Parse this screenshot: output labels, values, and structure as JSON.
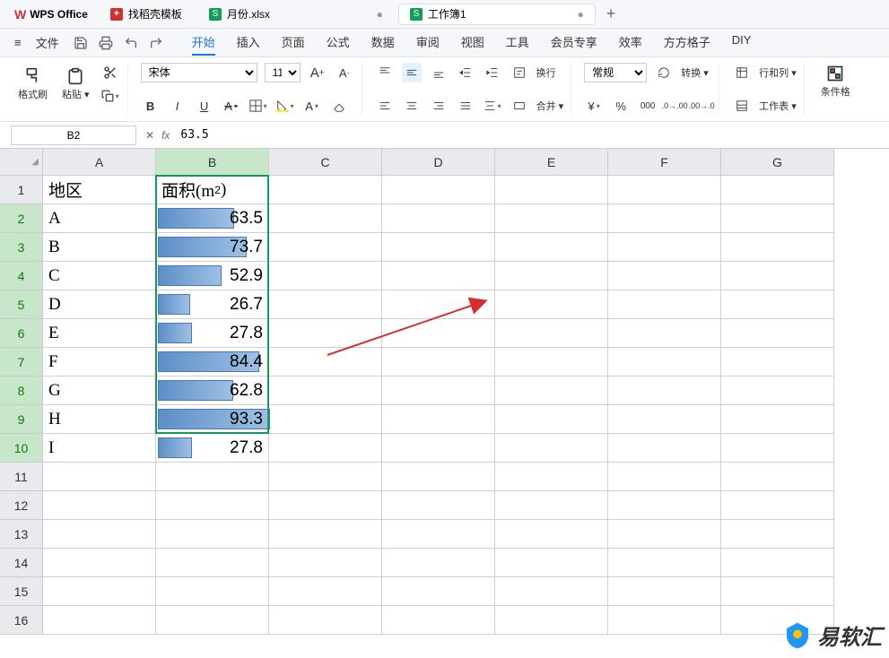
{
  "app": {
    "name": "WPS Office"
  },
  "tabs": [
    {
      "label": "找稻壳模板",
      "icon": "red"
    },
    {
      "label": "月份.xlsx",
      "icon": "green",
      "dirty": true
    },
    {
      "label": "工作簿1",
      "icon": "green",
      "dirty": true
    }
  ],
  "quickbar": {
    "file": "文件"
  },
  "menu": {
    "items": [
      "开始",
      "插入",
      "页面",
      "公式",
      "数据",
      "审阅",
      "视图",
      "工具",
      "会员专享",
      "效率",
      "方方格子",
      "DIY"
    ],
    "active": 0
  },
  "ribbon": {
    "format_painter": "格式刷",
    "paste": "粘贴",
    "font_name": "宋体",
    "font_size": "11",
    "wrap": "换行",
    "merge": "合并",
    "number_format": "常规",
    "rotate": "转换",
    "rowcol": "行和列",
    "worksheet": "工作表",
    "condfmt": "条件格"
  },
  "namebox": "B2",
  "formula": "63.5",
  "columns": [
    "A",
    "B",
    "C",
    "D",
    "E",
    "F",
    "G"
  ],
  "rows": [
    "1",
    "2",
    "3",
    "4",
    "5",
    "6",
    "7",
    "8",
    "9",
    "10",
    "11",
    "12",
    "13",
    "14",
    "15",
    "16"
  ],
  "headerRow": {
    "A": "地区",
    "B": "面积(m",
    "B_sup": "2",
    "B_close": ")"
  },
  "data": [
    {
      "region": "A",
      "area": "63.5",
      "bar": 68
    },
    {
      "region": "B",
      "area": "73.7",
      "bar": 79
    },
    {
      "region": "C",
      "area": "52.9",
      "bar": 57
    },
    {
      "region": "D",
      "area": "26.7",
      "bar": 29
    },
    {
      "region": "E",
      "area": "27.8",
      "bar": 30
    },
    {
      "region": "F",
      "area": "84.4",
      "bar": 90
    },
    {
      "region": "G",
      "area": "62.8",
      "bar": 67
    },
    {
      "region": "H",
      "area": "93.3",
      "bar": 100
    },
    {
      "region": "I",
      "area": "27.8",
      "bar": 30
    }
  ],
  "chart_data": {
    "type": "bar",
    "title": "面积(m²) databars",
    "categories": [
      "A",
      "B",
      "C",
      "D",
      "E",
      "F",
      "G",
      "H",
      "I"
    ],
    "values": [
      63.5,
      73.7,
      52.9,
      26.7,
      27.8,
      84.4,
      62.8,
      93.3,
      27.8
    ],
    "xlabel": "地区",
    "ylabel": "面积(m²)"
  },
  "watermark": {
    "text": "易软汇"
  }
}
